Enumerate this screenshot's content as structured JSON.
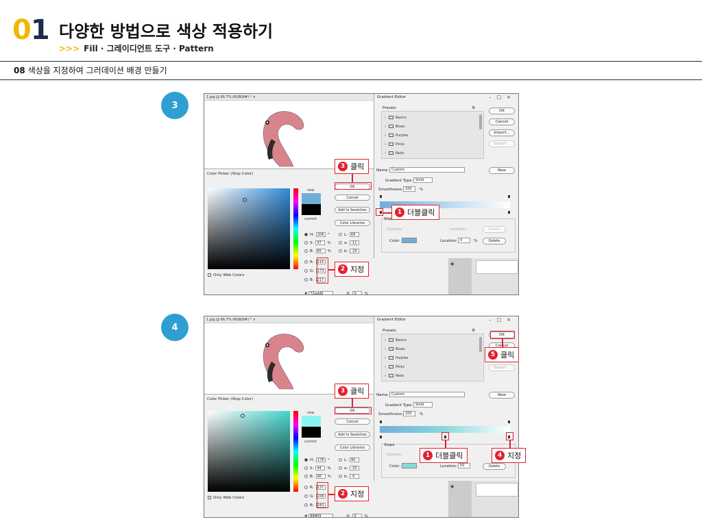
{
  "header": {
    "chapter_digit_0": "0",
    "chapter_digit_1": "1",
    "title": "다양한 방법으로 색상 적용하기",
    "subtitle_arrows": ">>>",
    "subtitle": "Fill · 그레이디언트 도구 · Pattern"
  },
  "section": {
    "number": "08",
    "title": "색상을 지정하여 그러데이션 배경 만들기"
  },
  "colors": {
    "accent_yellow": "#f2b705",
    "navy": "#1b2e4b",
    "step_blue": "#2e9fd0",
    "callout_red": "#e2202c"
  },
  "steps": [
    {
      "number": "3",
      "doc_tab": "1.jpg @ 66.7% (RGB/8#) *  ×",
      "color_picker": {
        "title": "Color Picker (Stop Color)",
        "new_label": "new",
        "current_label": "current",
        "new_color": "#72add9",
        "field_top_color": "#2f8ad9",
        "buttons": {
          "ok": "OK",
          "cancel": "Cancel",
          "add": "Add to Swatches",
          "libraries": "Color Libraries"
        },
        "hsb": {
          "H": "206",
          "S": "47",
          "B": "85"
        },
        "rgb": {
          "R": "114",
          "G": "173",
          "B": "217"
        },
        "lab": {
          "L": "68",
          "a": "-11",
          "b": "-29"
        },
        "k_value": "0",
        "hex": "72add9",
        "web_only": "Only Web Colors"
      },
      "gradient_editor": {
        "title": "Gradient Editor",
        "presets_label": "Presets",
        "folders": [
          "Basics",
          "Blues",
          "Purples",
          "Pinks",
          "Reds"
        ],
        "buttons": {
          "ok": "OK",
          "cancel": "Cancel",
          "import": "Import...",
          "export": "Export...",
          "new": "New"
        },
        "name_label": "Name:",
        "name_value": "Custom",
        "type_label": "Gradient Type:",
        "type_value": "Solid",
        "smooth_label": "Smoothness:",
        "smooth_value": "100",
        "stops_label": "Stops",
        "opacity_label": "Opacity:",
        "location_label": "Location:",
        "color_label": "Color:",
        "location_value": "0",
        "percent": "%",
        "delete": "Delete",
        "stop_color": "#72add9",
        "bar_from": "#72add9",
        "bar_to": "#ffffff"
      },
      "callouts": {
        "c1": {
          "num": "1",
          "text": "더블클릭"
        },
        "c2": {
          "num": "2",
          "text": "지정"
        },
        "c3": {
          "num": "3",
          "text": "클릭"
        }
      }
    },
    {
      "number": "4",
      "doc_tab": "1.jpg @ 66.7% (RGB/8#) *  ×",
      "color_picker": {
        "title": "Color Picker (Stop Color)",
        "new_label": "new",
        "current_label": "current",
        "new_color": "#89f6f3",
        "field_top_color": "#46d6cf",
        "buttons": {
          "ok": "OK",
          "cancel": "Cancel",
          "add": "Add to Swatches",
          "libraries": "Color Libraries"
        },
        "hsb": {
          "H": "178",
          "S": "44",
          "B": "96"
        },
        "rgb": {
          "R": "137",
          "G": "246",
          "B": "243"
        },
        "lab": {
          "L": "90",
          "a": "-33",
          "b": "-9"
        },
        "k_value": "0",
        "hex": "89f6f3",
        "web_only": "Only Web Colors"
      },
      "gradient_editor": {
        "title": "Gradient Editor",
        "presets_label": "Presets",
        "folders": [
          "Basics",
          "Blues",
          "Purples",
          "Pinks",
          "Reds"
        ],
        "buttons": {
          "ok": "OK",
          "cancel": "Cancel",
          "import": "Import...",
          "export": "Export...",
          "new": "New"
        },
        "name_label": "Name:",
        "name_value": "Custom",
        "type_label": "Gradient Type:",
        "type_value": "Solid",
        "smooth_label": "Smoothness:",
        "smooth_value": "100",
        "stops_label": "Stops",
        "opacity_label": "Opacity:",
        "location_label": "Location:",
        "color_label": "Color:",
        "location_value": "50",
        "percent": "%",
        "delete": "Delete",
        "stop_color": "#89d9dc",
        "bar_from": "#72add9",
        "bar_to": "#ffffff"
      },
      "callouts": {
        "c1": {
          "num": "1",
          "text": "더블클릭"
        },
        "c2": {
          "num": "2",
          "text": "지정"
        },
        "c3": {
          "num": "3",
          "text": "클릭"
        },
        "c4": {
          "num": "4",
          "text": "지정"
        },
        "c5": {
          "num": "5",
          "text": "클릭"
        }
      }
    }
  ]
}
